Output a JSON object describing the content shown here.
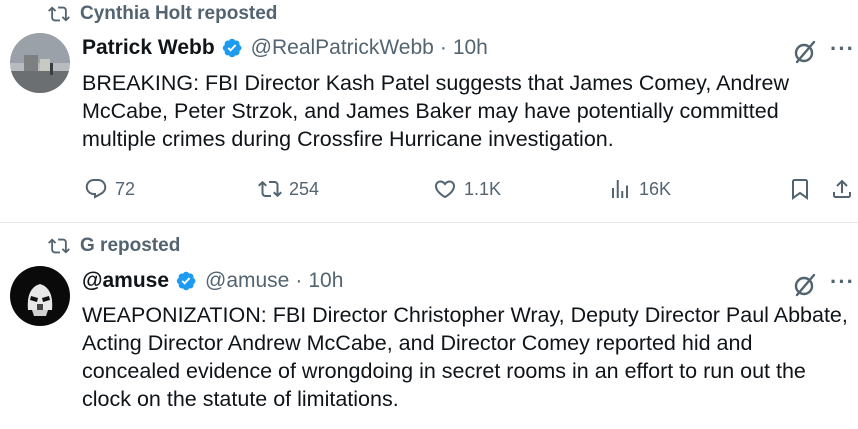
{
  "tweets": [
    {
      "repost_label": "Cynthia Holt reposted",
      "author_name": "Patrick Webb",
      "handle": "@RealPatrickWebb",
      "separator": "·",
      "time": "10h",
      "text": "BREAKING: FBI Director Kash Patel suggests that James Comey, Andrew McCabe, Peter Strzok, and James Baker may have potentially committed multiple crimes during Crossfire Hurricane investigation.",
      "metrics": {
        "replies": "72",
        "reposts": "254",
        "likes": "1.1K",
        "views": "16K"
      }
    },
    {
      "repost_label": "G reposted",
      "author_name": "@amuse",
      "handle": "@amuse",
      "separator": "·",
      "time": "10h",
      "text": "WEAPONIZATION: FBI Director Christopher Wray, Deputy Director Paul Abbate, Acting Director Andrew McCabe, and Director Comey reported hid and concealed evidence of wrongdoing in secret rooms in an effort to run out the clock on the statute of limitations."
    }
  ],
  "icons": {
    "repost": "repost-icon",
    "verified": "verified-badge-icon",
    "grok": "grok-icon",
    "more": "more-icon",
    "reply": "reply-icon",
    "like": "like-icon",
    "views": "views-icon",
    "bookmark": "bookmark-icon",
    "share": "share-icon"
  },
  "colors": {
    "text": "#0f1419",
    "muted": "#536471",
    "verified": "#1d9bf0",
    "divider": "#e6e9eb"
  }
}
